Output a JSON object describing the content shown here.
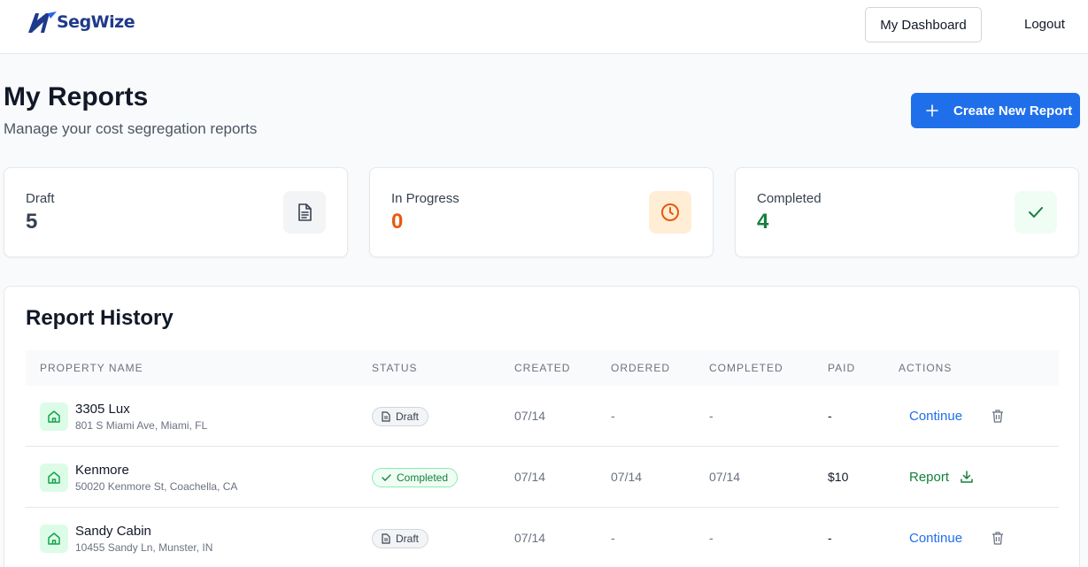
{
  "header": {
    "logo_text": "SegWize",
    "dashboard_label": "My Dashboard",
    "logout_label": "Logout"
  },
  "page": {
    "title": "My Reports",
    "subtitle": "Manage your cost segregation reports",
    "create_label": "Create New Report"
  },
  "stats": [
    {
      "label": "Draft",
      "value": "5",
      "color": "#374151",
      "icon": "document-icon"
    },
    {
      "label": "In Progress",
      "value": "0",
      "color": "#ea580c",
      "icon": "clock-icon"
    },
    {
      "label": "Completed",
      "value": "4",
      "color": "#15803d",
      "icon": "check-icon"
    }
  ],
  "history": {
    "title": "Report History",
    "columns": [
      "Property Name",
      "Status",
      "Created",
      "Ordered",
      "Completed",
      "Paid",
      "Actions"
    ],
    "rows": [
      {
        "name": "3305 Lux",
        "address": "801 S Miami Ave, Miami, FL",
        "status": "Draft",
        "created": "07/14",
        "ordered": "-",
        "completed": "-",
        "paid": "-",
        "action": "Continue"
      },
      {
        "name": "Kenmore",
        "address": "50020 Kenmore St, Coachella, CA",
        "status": "Completed",
        "created": "07/14",
        "ordered": "07/14",
        "completed": "07/14",
        "paid": "$10",
        "action": "Report"
      },
      {
        "name": "Sandy Cabin",
        "address": "10455 Sandy Ln, Munster, IN",
        "status": "Draft",
        "created": "07/14",
        "ordered": "-",
        "completed": "-",
        "paid": "-",
        "action": "Continue"
      }
    ]
  },
  "colors": {
    "primary": "#1f6feb",
    "success": "#15803d",
    "warning": "#ea580c"
  }
}
